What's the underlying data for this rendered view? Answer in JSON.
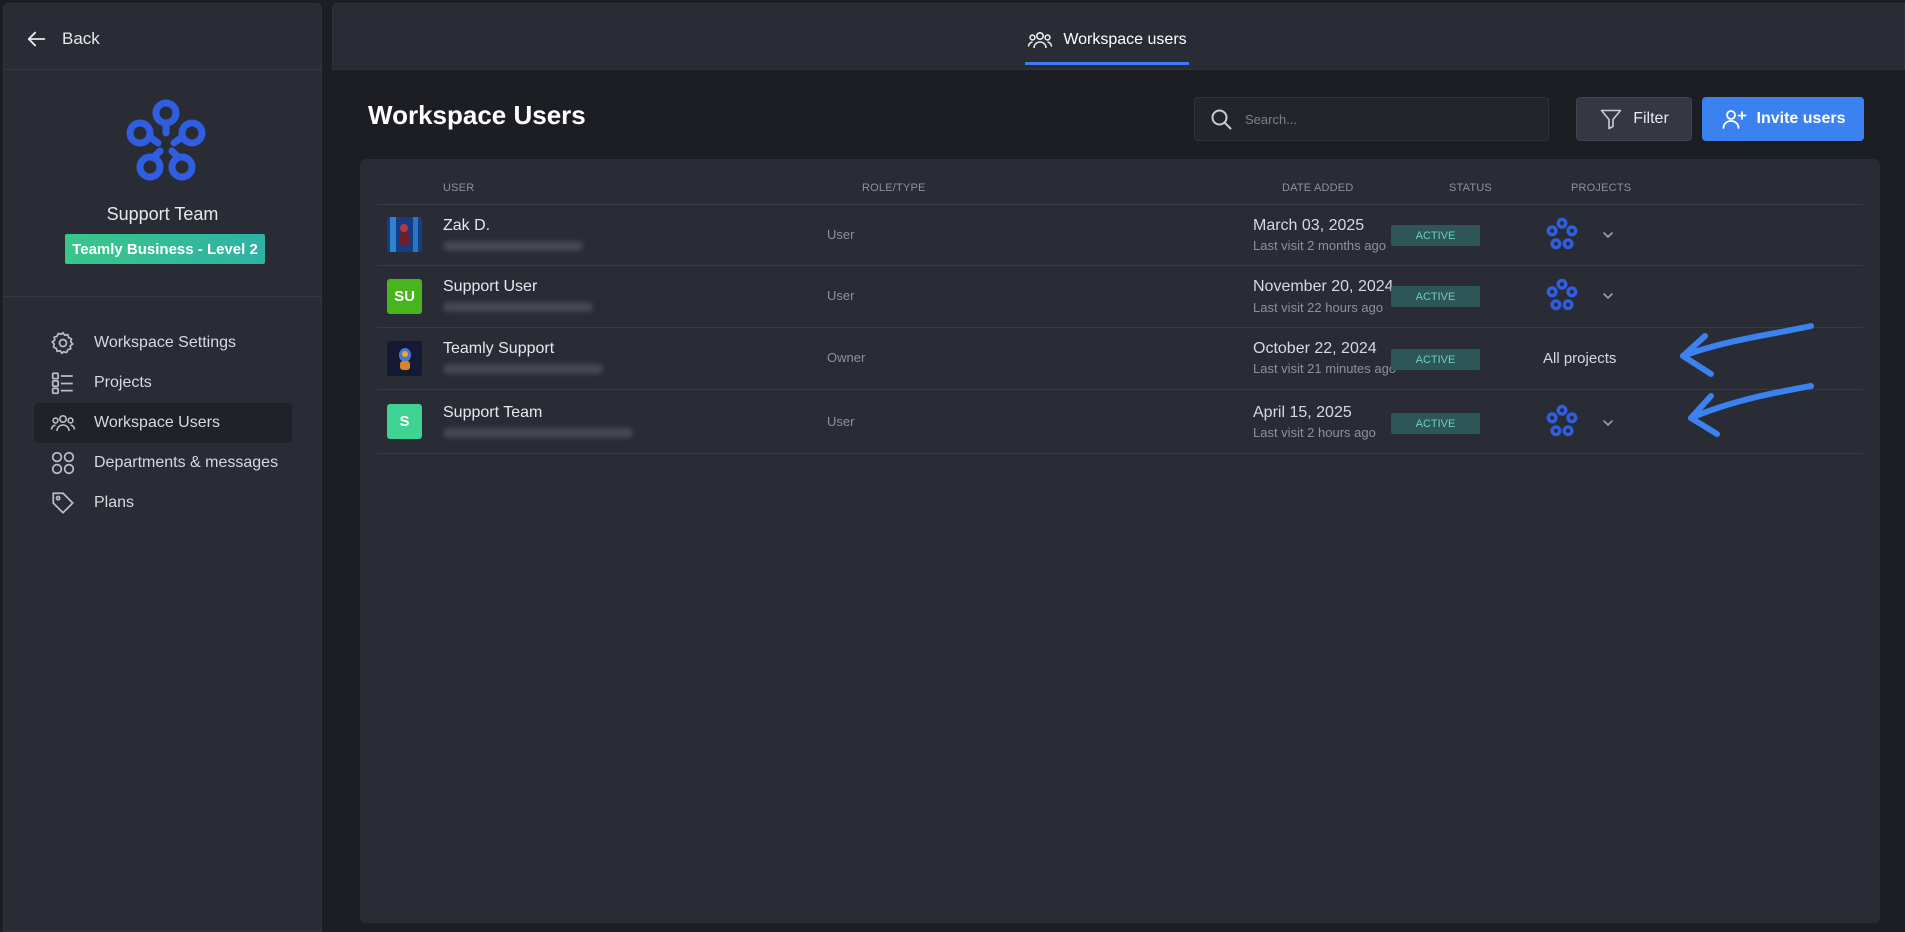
{
  "sidebar": {
    "back_label": "Back",
    "team_name": "Support Team",
    "plan_badge": "Teamly Business - Level 2",
    "items": [
      {
        "label": "Workspace Settings",
        "icon": "gear-icon"
      },
      {
        "label": "Projects",
        "icon": "list-icon"
      },
      {
        "label": "Workspace Users",
        "icon": "users-icon",
        "active": true
      },
      {
        "label": "Departments & messages",
        "icon": "grid-circles-icon"
      },
      {
        "label": "Plans",
        "icon": "tag-icon"
      }
    ]
  },
  "topbar": {
    "tab_label": "Workspace users"
  },
  "main": {
    "title": "Workspace Users",
    "search_placeholder": "Search...",
    "filter_label": "Filter",
    "invite_label": "Invite users"
  },
  "table": {
    "headers": {
      "user": "USER",
      "role": "ROLE/TYPE",
      "date": "DATE ADDED",
      "status": "STATUS",
      "projects": "PROJECTS"
    },
    "rows": [
      {
        "name": "Zak D.",
        "role": "User",
        "date": "March 03, 2025",
        "visit": "Last visit 2 months ago",
        "status": "ACTIVE",
        "projects": "icon"
      },
      {
        "name": "Support User",
        "avatar_text": "SU",
        "role": "User",
        "date": "November 20, 2024",
        "visit": "Last visit 22 hours ago",
        "status": "ACTIVE",
        "projects": "icon"
      },
      {
        "name": "Teamly Support",
        "role": "Owner",
        "date": "October 22, 2024",
        "visit": "Last visit 21 minutes ago",
        "status": "ACTIVE",
        "projects": "All projects"
      },
      {
        "name": "Support Team",
        "avatar_text": "S",
        "role": "User",
        "date": "April 15, 2025",
        "visit": "Last visit 2 hours ago",
        "status": "ACTIVE",
        "projects": "icon"
      }
    ]
  },
  "colors": {
    "accent": "#3b82f0",
    "logo_blue": "#2f5fe0",
    "status_bg": "#2f5656",
    "status_text": "#66d0c0",
    "badge_green": "#39c68a"
  }
}
